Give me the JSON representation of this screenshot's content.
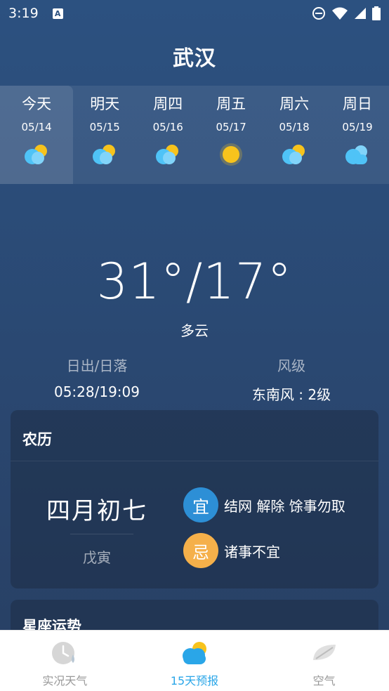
{
  "status_bar": {
    "time": "3:19",
    "app_icon_letter": "A",
    "icons": [
      "dnd-icon",
      "wifi-icon",
      "signal-icon",
      "battery-icon"
    ]
  },
  "header": {
    "city": "武汉"
  },
  "forecast": {
    "selected_index": 0,
    "days": [
      {
        "name": "今天",
        "date": "05/14",
        "icon": "partly-cloudy-icon"
      },
      {
        "name": "明天",
        "date": "05/15",
        "icon": "partly-cloudy-icon"
      },
      {
        "name": "周四",
        "date": "05/16",
        "icon": "partly-cloudy-icon"
      },
      {
        "name": "周五",
        "date": "05/17",
        "icon": "sunny-icon"
      },
      {
        "name": "周六",
        "date": "05/18",
        "icon": "partly-cloudy-icon"
      },
      {
        "name": "周日",
        "date": "05/19",
        "icon": "cloudy-icon"
      }
    ]
  },
  "current": {
    "temp_range": "31°/17°",
    "condition": "多云",
    "sun_label": "日出/日落",
    "sun_value": "05:28/19:09",
    "wind_label": "风级",
    "wind_value": "东南风 : 2级"
  },
  "lunar": {
    "title": "农历",
    "date": "四月初七",
    "ganzhi": "戊寅",
    "yi_badge": "宜",
    "yi_text": "结网 解除 馀事勿取",
    "ji_badge": "忌",
    "ji_text": "诸事不宜"
  },
  "astro": {
    "title": "星座运势"
  },
  "bottom_nav": {
    "items": [
      {
        "label": "实况天气",
        "icon": "clock-rain-icon"
      },
      {
        "label": "15天预报",
        "icon": "cloud-sun-icon"
      },
      {
        "label": "空气",
        "icon": "leaf-icon"
      }
    ],
    "active_index": 1
  },
  "colors": {
    "background": "#2c5180",
    "accent": "#2aa6e8",
    "yi_badge": "#2d8fd6",
    "ji_badge": "#f5b04a",
    "sun": "#f7c31c"
  }
}
